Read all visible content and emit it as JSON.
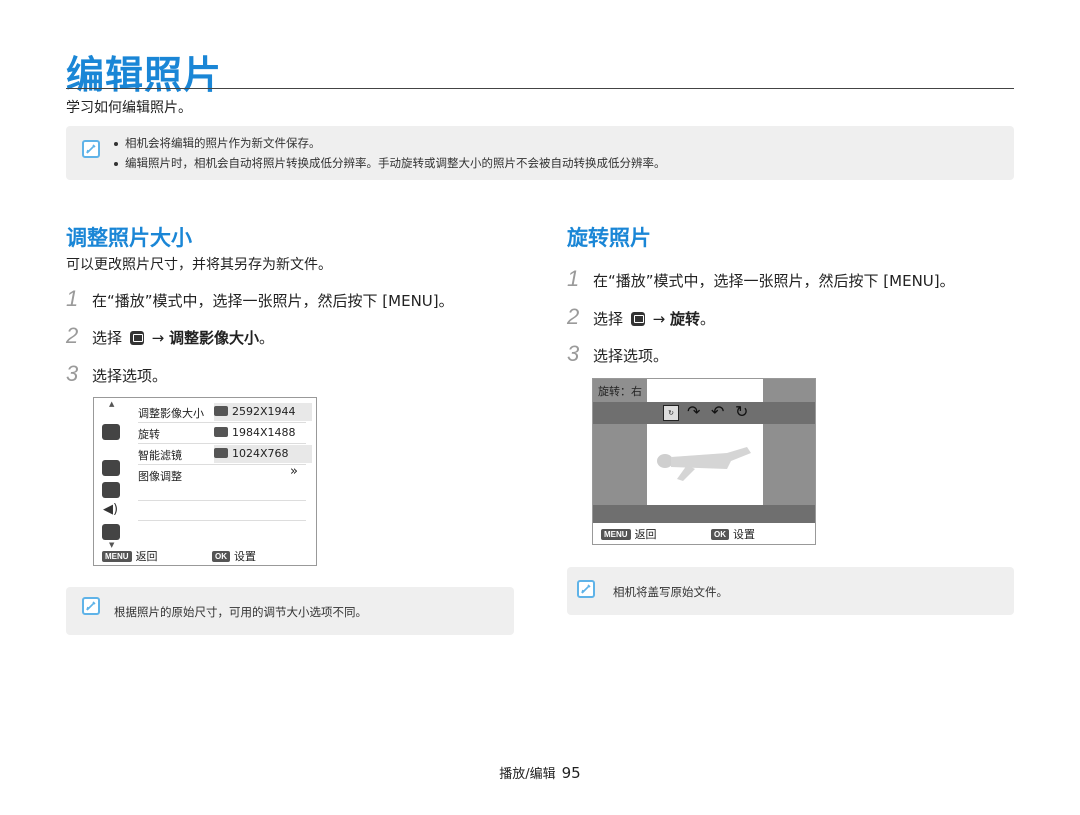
{
  "page": {
    "title": "编辑照片",
    "subtitle": "学习如何编辑照片。",
    "footer_section": "播放/编辑",
    "page_number": "95"
  },
  "notes": {
    "top": [
      "相机会将编辑的照片作为新文件保存。",
      "编辑照片时，相机会自动将照片转换成低分辨率。手动旋转或调整大小的照片不会被自动转换成低分辨率。"
    ],
    "resize": "根据照片的原始尺寸，可用的调节大小选项不同。",
    "rotate": "相机将盖写原始文件。"
  },
  "resize": {
    "heading": "调整照片大小",
    "intro": "可以更改照片尺寸，并将其另存为新文件。",
    "steps": [
      {
        "num": "1",
        "text": "在“播放”模式中，选择一张照片，然后按下 [MENU]。"
      },
      {
        "num": "2",
        "prefix": "选择",
        "arrow": "→",
        "bold": "调整影像大小",
        "suffix": "。"
      },
      {
        "num": "3",
        "text": "选择选项。"
      }
    ],
    "screen": {
      "menu_items": [
        "调整影像大小",
        "旋转",
        "智能滤镜",
        "图像调整"
      ],
      "options": [
        "2592X1944",
        "1984X1488",
        "1024X768"
      ],
      "more_glyph": "»",
      "back_key": "MENU",
      "back_label": "返回",
      "ok_key": "OK",
      "ok_label": "设置"
    }
  },
  "rotate": {
    "heading": "旋转照片",
    "steps": [
      {
        "num": "1",
        "text": "在“播放”模式中，选择一张照片，然后按下 [MENU]。"
      },
      {
        "num": "2",
        "prefix": "选择",
        "arrow": "→",
        "bold": "旋转",
        "suffix": "。"
      },
      {
        "num": "3",
        "text": "选择选项。"
      }
    ],
    "screen": {
      "label": "旋转：右",
      "back_key": "MENU",
      "back_label": "返回",
      "ok_key": "OK",
      "ok_label": "设置"
    }
  },
  "colors": {
    "accent": "#1a86d6",
    "note_bg": "#efefef",
    "note_icon": "#5fb3e8"
  }
}
